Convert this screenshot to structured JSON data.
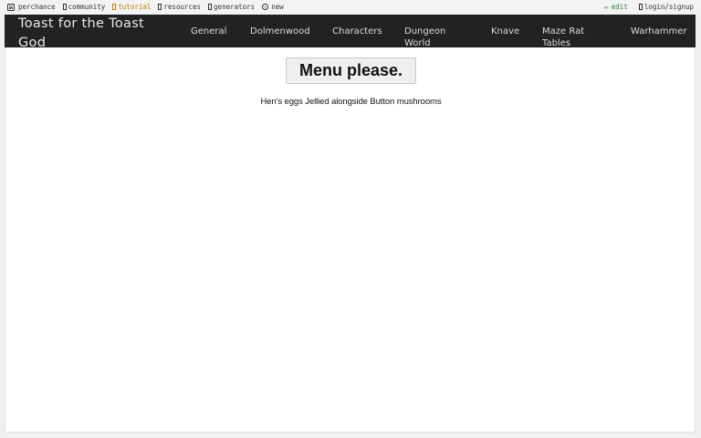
{
  "topbar": {
    "left": [
      {
        "label": "perchance",
        "icon": "dice-icon"
      },
      {
        "label": "community",
        "icon": "doc-icon"
      },
      {
        "label": "tutorial",
        "icon": "doc-icon"
      },
      {
        "label": "resources",
        "icon": "doc-icon"
      },
      {
        "label": "generators",
        "icon": "doc-icon"
      },
      {
        "label": "new",
        "icon": "globe-icon"
      }
    ],
    "right": [
      {
        "label": "edit",
        "icon": "pencil-icon"
      },
      {
        "label": "login/signup",
        "icon": "doc-icon"
      }
    ],
    "colors": {
      "tutorial": "#c87a00",
      "edit": "#2e8b2e"
    }
  },
  "navbar": {
    "brand": "Toast for the Toast God",
    "links": [
      "General",
      "Dolmenwood",
      "Characters",
      "Dungeon World",
      "Knave",
      "Maze Rat Tables",
      "Warhammer"
    ],
    "background": "#222222"
  },
  "main": {
    "button_label": "Menu please.",
    "output_text": "Hen's eggs Jellied alongside Button mushrooms"
  }
}
